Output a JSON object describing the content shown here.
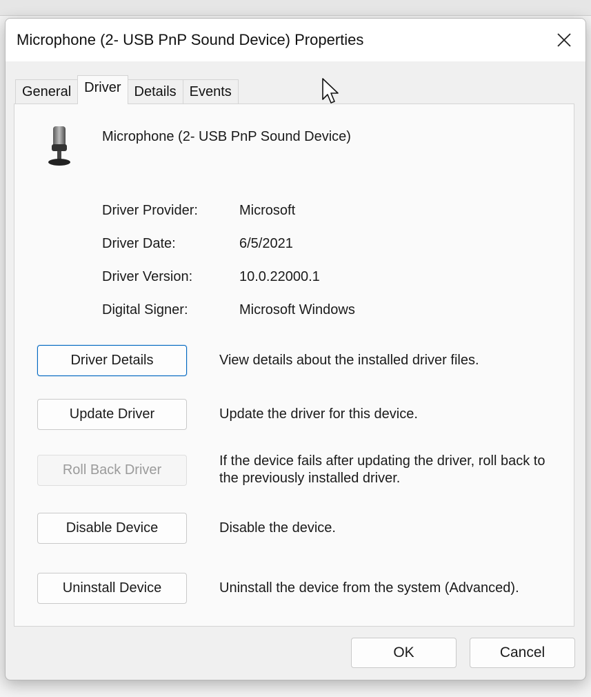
{
  "dialog": {
    "title": "Microphone (2- USB PnP Sound Device) Properties"
  },
  "tabs": [
    {
      "label": "General"
    },
    {
      "label": "Driver"
    },
    {
      "label": "Details"
    },
    {
      "label": "Events"
    }
  ],
  "active_tab": "Driver",
  "device": {
    "name": "Microphone (2- USB PnP Sound Device)",
    "icon": "microphone-icon"
  },
  "properties": [
    {
      "label": "Driver Provider:",
      "value": "Microsoft"
    },
    {
      "label": "Driver Date:",
      "value": "6/5/2021"
    },
    {
      "label": "Driver Version:",
      "value": "10.0.22000.1"
    },
    {
      "label": "Digital Signer:",
      "value": "Microsoft Windows"
    }
  ],
  "actions": [
    {
      "label": "Driver Details",
      "description": "View details about the installed driver files.",
      "state": "focused"
    },
    {
      "label": "Update Driver",
      "description": "Update the driver for this device.",
      "state": "enabled"
    },
    {
      "label": "Roll Back Driver",
      "description": "If the device fails after updating the driver, roll back to the previously installed driver.",
      "state": "disabled"
    },
    {
      "label": "Disable Device",
      "description": "Disable the device.",
      "state": "enabled"
    },
    {
      "label": "Uninstall Device",
      "description": "Uninstall the device from the system (Advanced).",
      "state": "enabled"
    }
  ],
  "footer": {
    "ok_label": "OK",
    "cancel_label": "Cancel"
  },
  "colors": {
    "focus_border": "#0067c0",
    "dialog_bg": "#f0f0f0",
    "panel_bg": "#fafafa",
    "disabled_text": "#9b9b9b"
  }
}
